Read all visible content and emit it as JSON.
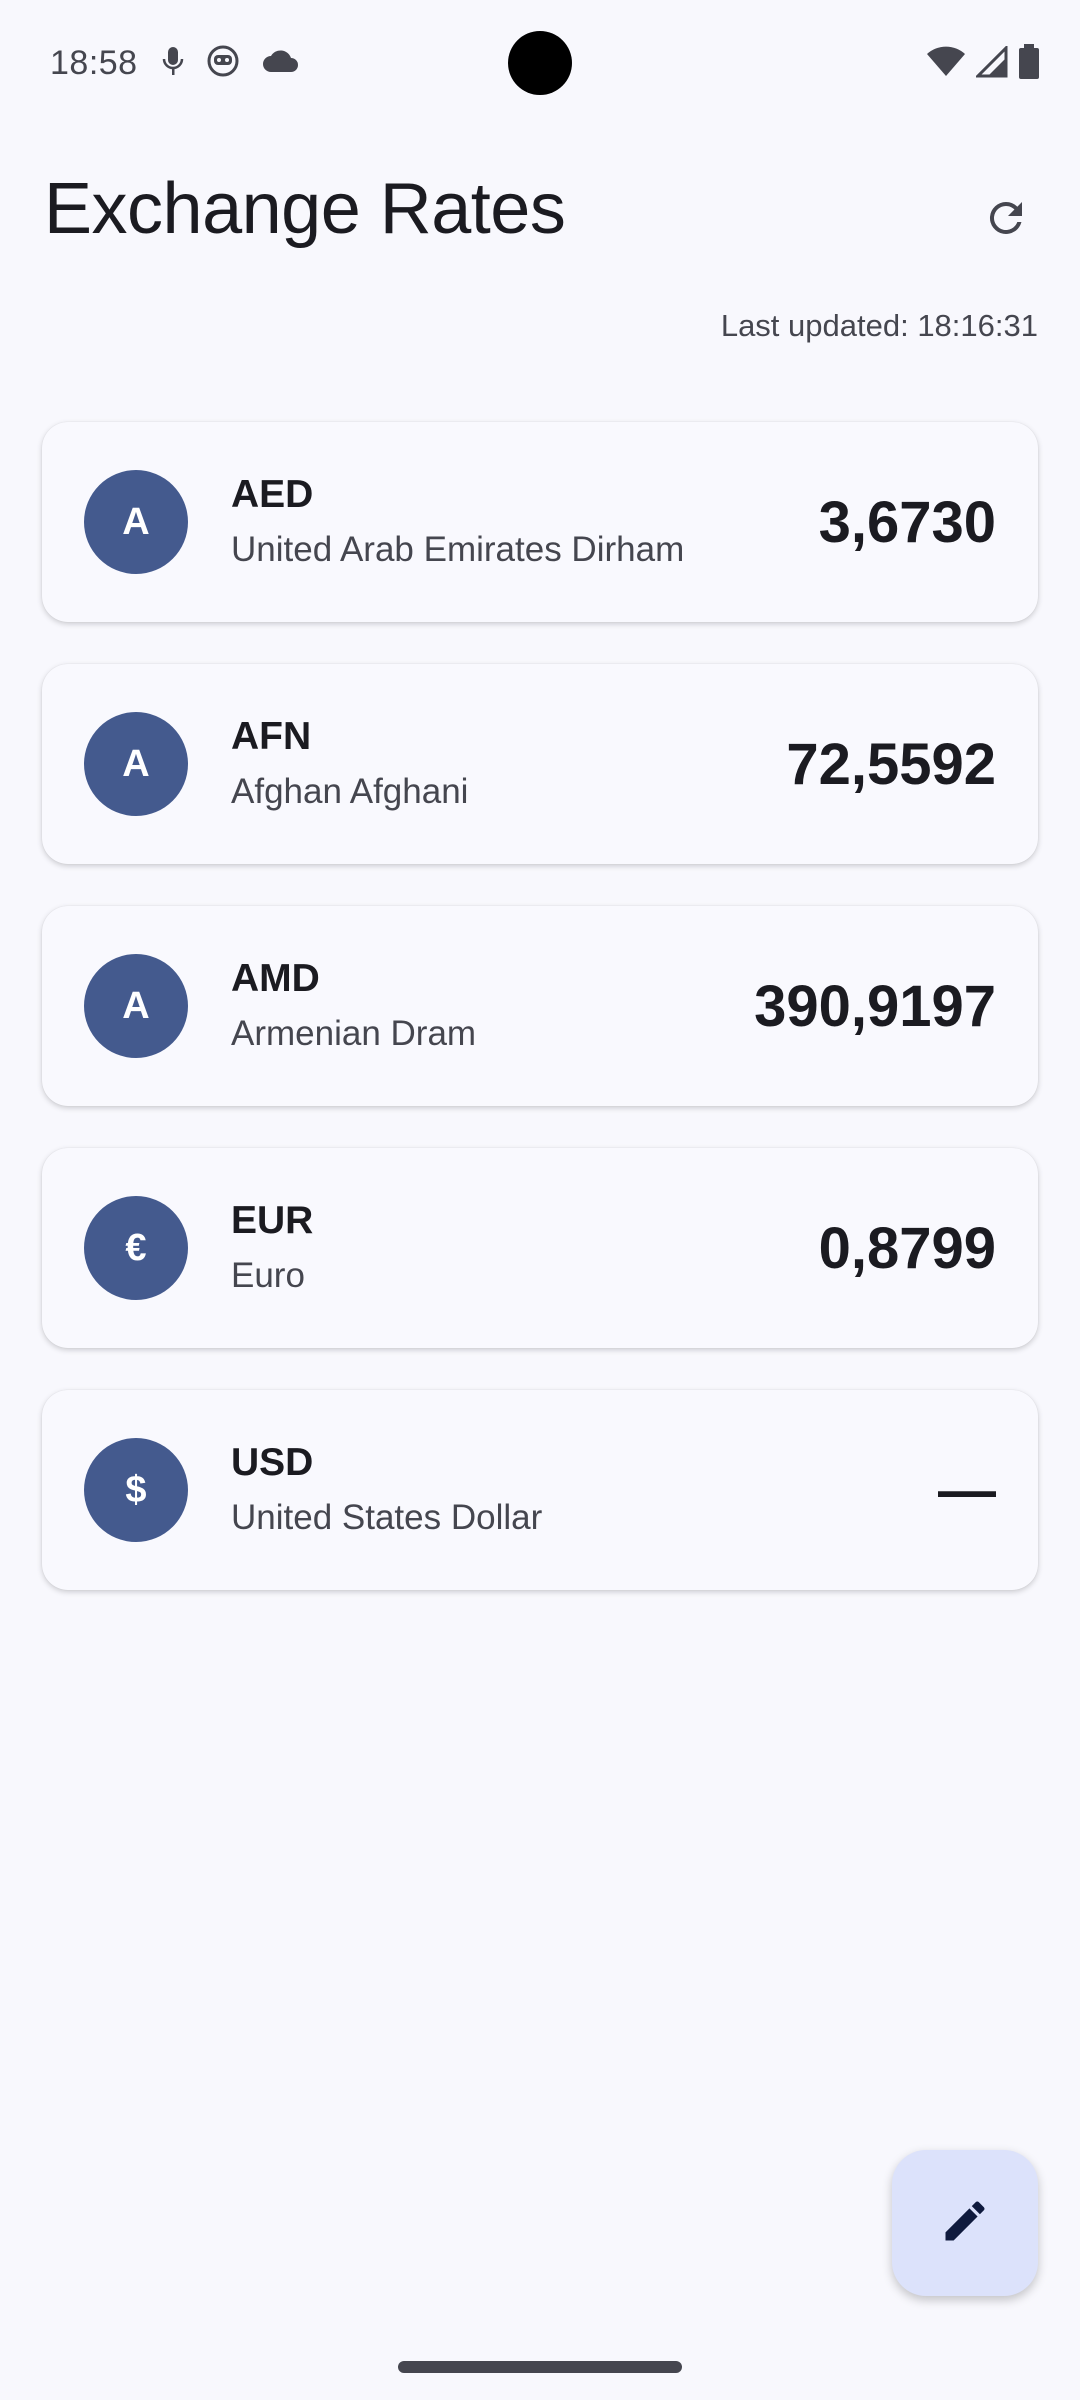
{
  "status_bar": {
    "time": "18:58",
    "left_icons": [
      "mic-icon",
      "robot-face-icon",
      "cloud-icon"
    ],
    "right_icons": [
      "wifi-icon",
      "cellular-signal-icon",
      "battery-icon"
    ]
  },
  "header": {
    "title": "Exchange Rates",
    "refresh_icon": "refresh-icon",
    "last_updated": "Last updated: 18:16:31"
  },
  "rates": [
    {
      "avatar": "A",
      "code": "AED",
      "name": "United Arab Emirates Dirham",
      "rate": "3,6730"
    },
    {
      "avatar": "A",
      "code": "AFN",
      "name": "Afghan Afghani",
      "rate": "72,5592"
    },
    {
      "avatar": "A",
      "code": "AMD",
      "name": "Armenian Dram",
      "rate": "390,9197"
    },
    {
      "avatar": "€",
      "code": "EUR",
      "name": "Euro",
      "rate": "0,8799"
    },
    {
      "avatar": "$",
      "code": "USD",
      "name": "United States Dollar",
      "rate": "—"
    }
  ],
  "fab": {
    "icon": "edit-pencil-icon"
  },
  "colors": {
    "background": "#f8f8fd",
    "avatar": "#445a8e",
    "fab": "#dce2fb",
    "text_primary": "#1b1b21",
    "text_secondary": "#45464f"
  }
}
